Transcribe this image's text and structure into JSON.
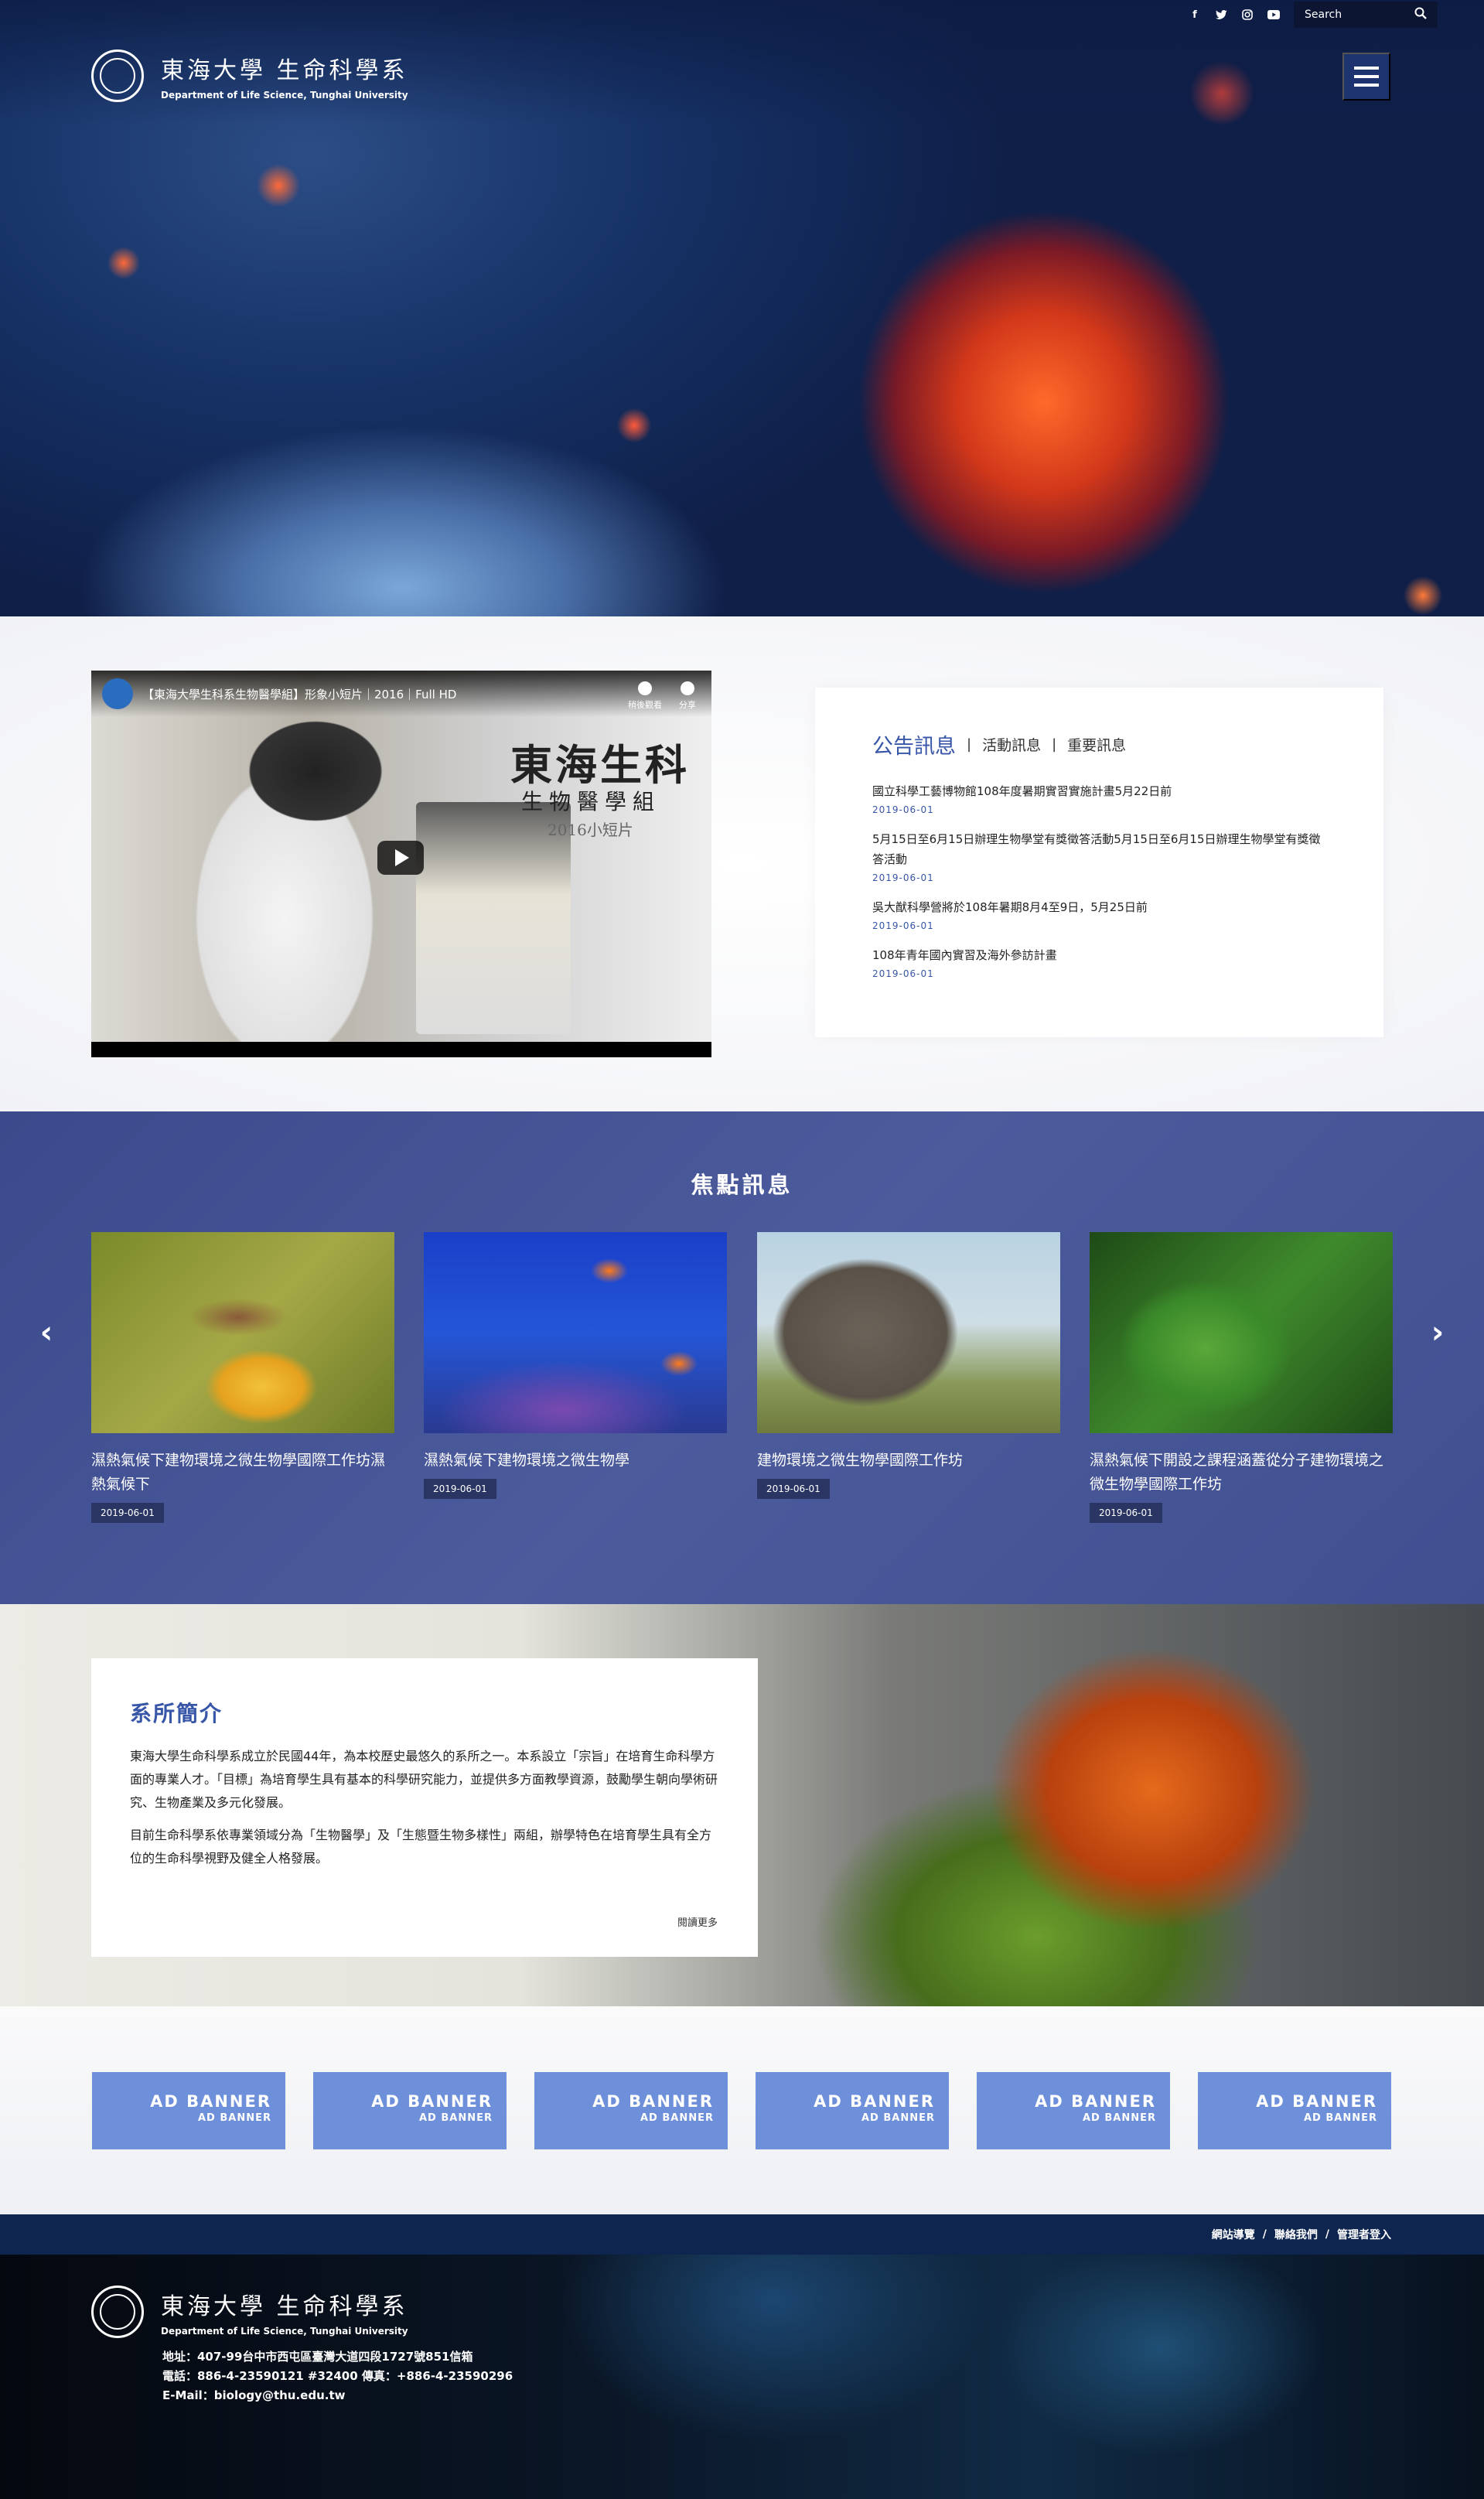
{
  "header": {
    "search_placeholder": "Search",
    "brand_zh": "東海大學 生命科學系",
    "brand_en": "Department of Life Science, Tunghai University",
    "social": [
      "facebook-icon",
      "twitter-icon",
      "instagram-icon",
      "youtube-icon"
    ]
  },
  "video": {
    "title": "【東海大學生科系生物醫學組】形象小短片｜2016｜Full HD",
    "big": "東海生科",
    "sub": "生物醫學組",
    "sub2": "2016小短片",
    "watch_later": "稍後觀看",
    "share": "分享"
  },
  "news": {
    "tabs": [
      "公告訊息",
      "活動訊息",
      "重要訊息"
    ],
    "items": [
      {
        "title": "國立科學工藝博物館108年度暑期實習實施計畫5月22日前",
        "date": "2019-06-01"
      },
      {
        "title": "5月15日至6月15日辦理生物學堂有獎徵答活動5月15日至6月15日辦理生物學堂有獎徵答活動",
        "date": "2019-06-01"
      },
      {
        "title": "吳大猷科學營將於108年暑期8月4至9日，5月25日前",
        "date": "2019-06-01"
      },
      {
        "title": "108年青年國內實習及海外參訪計畫",
        "date": "2019-06-01"
      }
    ]
  },
  "focus": {
    "title": "焦點訊息",
    "cards": [
      {
        "title": "濕熱氣候下建物環境之微生物學國際工作坊濕熱氣候下",
        "date": "2019-06-01"
      },
      {
        "title": "濕熱氣候下建物環境之微生物學",
        "date": "2019-06-01"
      },
      {
        "title": "建物環境之微生物學國際工作坊",
        "date": "2019-06-01"
      },
      {
        "title": "濕熱氣候下開設之課程涵蓋從分子建物環境之微生物學國際工作坊",
        "date": "2019-06-01"
      }
    ]
  },
  "about": {
    "title": "系所簡介",
    "p1": "東海大學生命科學系成立於民國44年，為本校歷史最悠久的系所之一。本系設立「宗旨」在培育生命科學方面的專業人才。「目標」為培育學生具有基本的科學研究能力，並提供多方面教學資源，鼓勵學生朝向學術研究、生物產業及多元化發展。",
    "p2": "目前生命科學系依專業領域分為「生物醫學」及「生態暨生物多樣性」兩組，辦學特色在培育學生具有全方位的生命科學視野及健全人格發展。",
    "more": "閱讀更多"
  },
  "banners": [
    {
      "main": "AD BANNER",
      "sub": "AD BANNER"
    },
    {
      "main": "AD BANNER",
      "sub": "AD BANNER"
    },
    {
      "main": "AD BANNER",
      "sub": "AD BANNER"
    },
    {
      "main": "AD BANNER",
      "sub": "AD BANNER"
    },
    {
      "main": "AD BANNER",
      "sub": "AD BANNER"
    },
    {
      "main": "AD BANNER",
      "sub": "AD BANNER"
    }
  ],
  "footer": {
    "links": [
      "網站導覽",
      "聯絡我們",
      "管理者登入"
    ],
    "brand_zh": "東海大學 生命科學系",
    "brand_en": "Department of Life Science, Tunghai University",
    "address": "地址：407-99台中市西屯區臺灣大道四段1727號851信箱",
    "phone": "電話：886-4-23590121 #32400 傳真：+886-4-23590296",
    "email": "E-Mail：biology@thu.edu.tw"
  },
  "colors": {
    "accent": "#3756a8",
    "focus_bg": "#44549a",
    "banner": "#6e8fda",
    "footer_bar": "#0e2550"
  }
}
